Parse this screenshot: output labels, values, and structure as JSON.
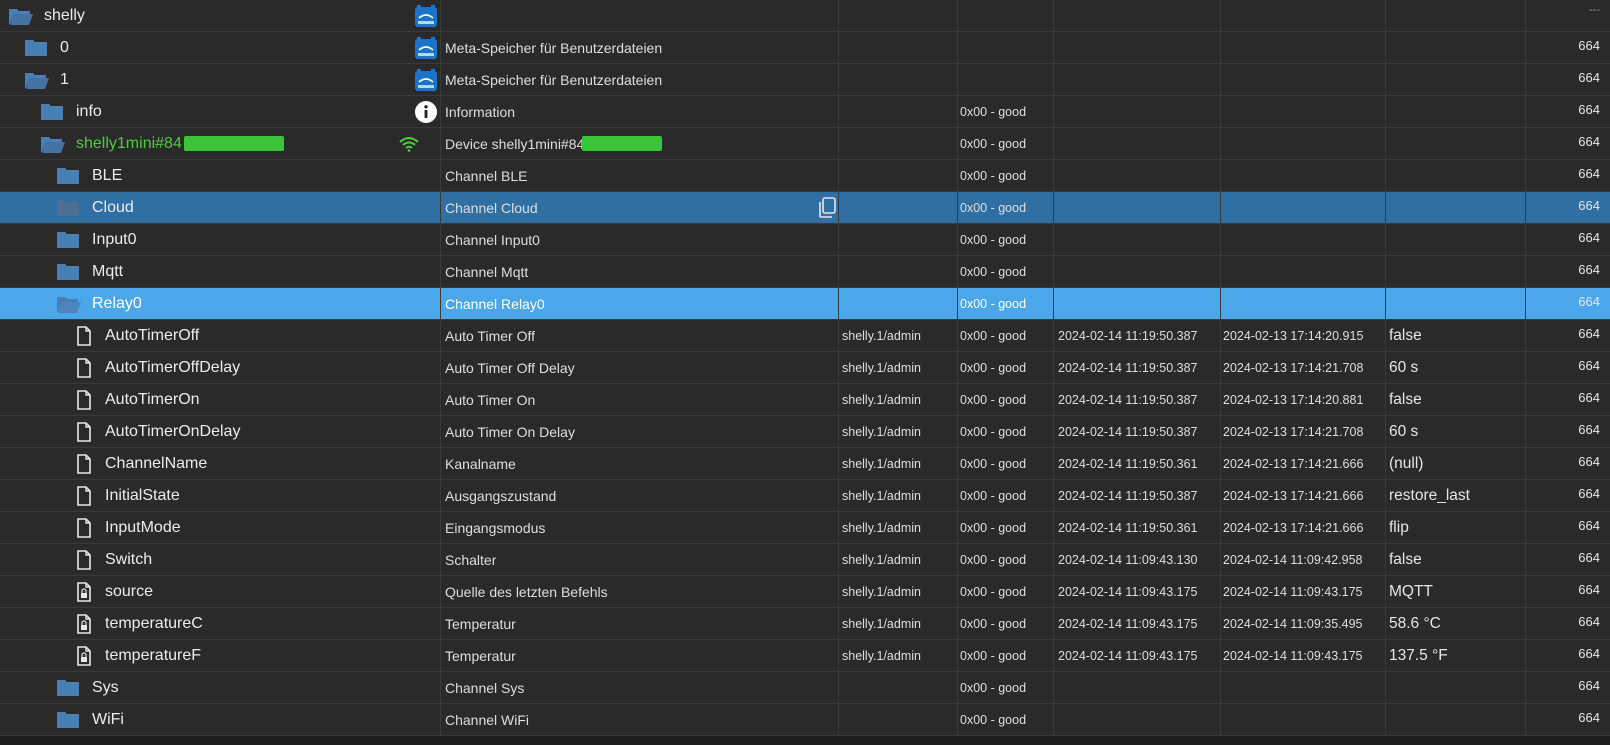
{
  "header": {
    "acl_label": "---"
  },
  "selected_copy_icon": "copy-icon",
  "rows": [
    {
      "name": "shelly",
      "desc": "",
      "role": "",
      "status": "",
      "ts": "",
      "lc": "",
      "value": "",
      "acl": "",
      "icon": "folder-open-icon",
      "indent": 0,
      "type": "folder-open",
      "badge": "shelly-adapter-icon"
    },
    {
      "name": "0",
      "desc": "Meta-Speicher für Benutzerdateien",
      "role": "",
      "status": "",
      "ts": "",
      "lc": "",
      "value": "",
      "acl": "664",
      "icon": "folder-icon",
      "indent": 1,
      "type": "folder",
      "badge": "shelly-adapter-icon"
    },
    {
      "name": "1",
      "desc": "Meta-Speicher für Benutzerdateien",
      "role": "",
      "status": "",
      "ts": "",
      "lc": "",
      "value": "",
      "acl": "664",
      "icon": "folder-open-icon",
      "indent": 1,
      "type": "folder-open",
      "badge": "shelly-adapter-icon"
    },
    {
      "name": "info",
      "desc": "Information",
      "role": "",
      "status": "0x00 - good",
      "ts": "",
      "lc": "",
      "value": "",
      "acl": "664",
      "icon": "folder-icon",
      "indent": 2,
      "type": "folder",
      "badge": "info-icon"
    },
    {
      "name": "shelly1mini#84",
      "desc": "Device shelly1mini#84f",
      "role": "",
      "status": "0x00 - good",
      "ts": "",
      "lc": "",
      "value": "",
      "acl": "664",
      "icon": "folder-open-icon",
      "indent": 2,
      "type": "folder-open",
      "badge": "wifi-icon",
      "green": true
    },
    {
      "name": "BLE",
      "desc": "Channel BLE",
      "role": "",
      "status": "0x00 - good",
      "ts": "",
      "lc": "",
      "value": "",
      "acl": "664",
      "icon": "folder-icon",
      "indent": 3,
      "type": "folder"
    },
    {
      "name": "Cloud",
      "desc": "Channel Cloud",
      "role": "",
      "status": "0x00 - good",
      "ts": "",
      "lc": "",
      "value": "",
      "acl": "664",
      "icon": "folder-icon",
      "indent": 3,
      "type": "folder",
      "sel": "dark"
    },
    {
      "name": "Input0",
      "desc": "Channel Input0",
      "role": "",
      "status": "0x00 - good",
      "ts": "",
      "lc": "",
      "value": "",
      "acl": "664",
      "icon": "folder-icon",
      "indent": 3,
      "type": "folder"
    },
    {
      "name": "Mqtt",
      "desc": "Channel Mqtt",
      "role": "",
      "status": "0x00 - good",
      "ts": "",
      "lc": "",
      "value": "",
      "acl": "664",
      "icon": "folder-icon",
      "indent": 3,
      "type": "folder"
    },
    {
      "name": "Relay0",
      "desc": "Channel Relay0",
      "role": "",
      "status": "0x00 - good",
      "ts": "",
      "lc": "",
      "value": "",
      "acl": "664",
      "icon": "folder-open-icon",
      "indent": 3,
      "type": "folder-open",
      "sel": "light"
    },
    {
      "name": "AutoTimerOff",
      "desc": "Auto Timer Off",
      "role": "shelly.1/admin",
      "status": "0x00 - good",
      "ts": "2024-02-14 11:19:50.387",
      "lc": "2024-02-13 17:14:20.915",
      "value": "false",
      "acl": "664",
      "icon": "file-icon",
      "indent": 4,
      "type": "file"
    },
    {
      "name": "AutoTimerOffDelay",
      "desc": "Auto Timer Off Delay",
      "role": "shelly.1/admin",
      "status": "0x00 - good",
      "ts": "2024-02-14 11:19:50.387",
      "lc": "2024-02-13 17:14:21.708",
      "value": "60 s",
      "acl": "664",
      "icon": "file-icon",
      "indent": 4,
      "type": "file"
    },
    {
      "name": "AutoTimerOn",
      "desc": "Auto Timer On",
      "role": "shelly.1/admin",
      "status": "0x00 - good",
      "ts": "2024-02-14 11:19:50.387",
      "lc": "2024-02-13 17:14:20.881",
      "value": "false",
      "acl": "664",
      "icon": "file-icon",
      "indent": 4,
      "type": "file"
    },
    {
      "name": "AutoTimerOnDelay",
      "desc": "Auto Timer On Delay",
      "role": "shelly.1/admin",
      "status": "0x00 - good",
      "ts": "2024-02-14 11:19:50.387",
      "lc": "2024-02-13 17:14:21.708",
      "value": "60 s",
      "acl": "664",
      "icon": "file-icon",
      "indent": 4,
      "type": "file"
    },
    {
      "name": "ChannelName",
      "desc": "Kanalname",
      "role": "shelly.1/admin",
      "status": "0x00 - good",
      "ts": "2024-02-14 11:19:50.361",
      "lc": "2024-02-13 17:14:21.666",
      "value": "(null)",
      "acl": "664",
      "icon": "file-icon",
      "indent": 4,
      "type": "file"
    },
    {
      "name": "InitialState",
      "desc": "Ausgangszustand",
      "role": "shelly.1/admin",
      "status": "0x00 - good",
      "ts": "2024-02-14 11:19:50.387",
      "lc": "2024-02-13 17:14:21.666",
      "value": "restore_last",
      "acl": "664",
      "icon": "file-icon",
      "indent": 4,
      "type": "file"
    },
    {
      "name": "InputMode",
      "desc": "Eingangsmodus",
      "role": "shelly.1/admin",
      "status": "0x00 - good",
      "ts": "2024-02-14 11:19:50.361",
      "lc": "2024-02-13 17:14:21.666",
      "value": "flip",
      "acl": "664",
      "icon": "file-icon",
      "indent": 4,
      "type": "file"
    },
    {
      "name": "Switch",
      "desc": "Schalter",
      "role": "shelly.1/admin",
      "status": "0x00 - good",
      "ts": "2024-02-14 11:09:43.130",
      "lc": "2024-02-14 11:09:42.958",
      "value": "false",
      "acl": "664",
      "icon": "file-icon",
      "indent": 4,
      "type": "file"
    },
    {
      "name": "source",
      "desc": "Quelle des letzten Befehls",
      "role": "shelly.1/admin",
      "status": "0x00 - good",
      "ts": "2024-02-14 11:09:43.175",
      "lc": "2024-02-14 11:09:43.175",
      "value": "MQTT",
      "acl": "664",
      "icon": "file-lock-icon",
      "indent": 4,
      "type": "file-lock"
    },
    {
      "name": "temperatureC",
      "desc": "Temperatur",
      "role": "shelly.1/admin",
      "status": "0x00 - good",
      "ts": "2024-02-14 11:09:43.175",
      "lc": "2024-02-14 11:09:35.495",
      "value": "58.6 °C",
      "acl": "664",
      "icon": "file-lock-icon",
      "indent": 4,
      "type": "file-lock"
    },
    {
      "name": "temperatureF",
      "desc": "Temperatur",
      "role": "shelly.1/admin",
      "status": "0x00 - good",
      "ts": "2024-02-14 11:09:43.175",
      "lc": "2024-02-14 11:09:43.175",
      "value": "137.5 °F",
      "acl": "664",
      "icon": "file-lock-icon",
      "indent": 4,
      "type": "file-lock"
    },
    {
      "name": "Sys",
      "desc": "Channel Sys",
      "role": "",
      "status": "0x00 - good",
      "ts": "",
      "lc": "",
      "value": "",
      "acl": "664",
      "icon": "folder-icon",
      "indent": 3,
      "type": "folder"
    },
    {
      "name": "WiFi",
      "desc": "Channel WiFi",
      "role": "",
      "status": "0x00 - good",
      "ts": "",
      "lc": "",
      "value": "",
      "acl": "664",
      "icon": "folder-icon",
      "indent": 3,
      "type": "folder"
    }
  ]
}
